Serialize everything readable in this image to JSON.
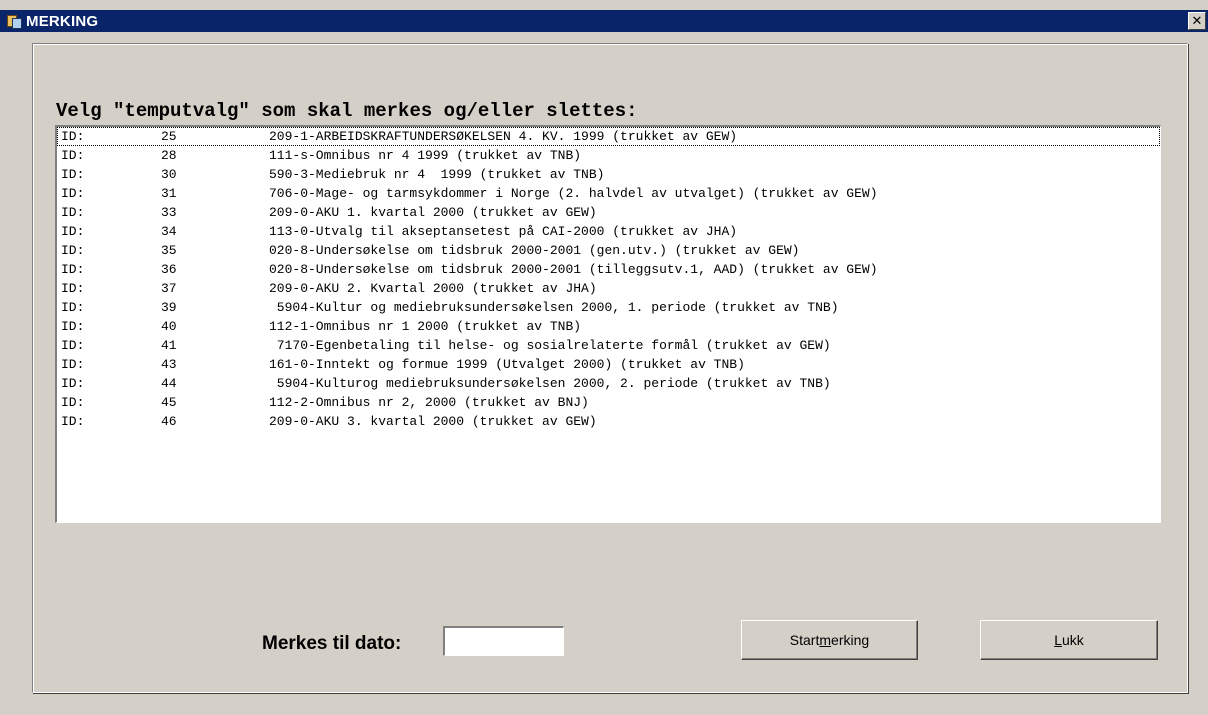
{
  "window": {
    "title": "MERKING",
    "close_glyph": "✕"
  },
  "heading": "Velg \"temputvalg\" som skal merkes og/eller slettes:",
  "list": {
    "items": [
      {
        "id_label": "ID:",
        "id": "25",
        "desc": "209-1-ARBEIDSKRAFTUNDERSØKELSEN 4. KV. 1999 (trukket av GEW)"
      },
      {
        "id_label": "ID:",
        "id": "28",
        "desc": "111-s-Omnibus nr 4 1999 (trukket av TNB)"
      },
      {
        "id_label": "ID:",
        "id": "30",
        "desc": "590-3-Mediebruk nr 4  1999 (trukket av TNB)"
      },
      {
        "id_label": "ID:",
        "id": "31",
        "desc": "706-0-Mage- og tarmsykdommer i Norge (2. halvdel av utvalget) (trukket av GEW)"
      },
      {
        "id_label": "ID:",
        "id": "33",
        "desc": "209-0-AKU 1. kvartal 2000 (trukket av GEW)"
      },
      {
        "id_label": "ID:",
        "id": "34",
        "desc": "113-0-Utvalg til akseptansetest på CAI-2000 (trukket av JHA)"
      },
      {
        "id_label": "ID:",
        "id": "35",
        "desc": "020-8-Undersøkelse om tidsbruk 2000-2001 (gen.utv.) (trukket av GEW)"
      },
      {
        "id_label": "ID:",
        "id": "36",
        "desc": "020-8-Undersøkelse om tidsbruk 2000-2001 (tilleggsutv.1, AAD) (trukket av GEW)"
      },
      {
        "id_label": "ID:",
        "id": "37",
        "desc": "209-0-AKU 2. Kvartal 2000 (trukket av JHA)"
      },
      {
        "id_label": "ID:",
        "id": "39",
        "desc": " 5904-Kultur og mediebruksundersøkelsen 2000, 1. periode (trukket av TNB)"
      },
      {
        "id_label": "ID:",
        "id": "40",
        "desc": "112-1-Omnibus nr 1 2000 (trukket av TNB)"
      },
      {
        "id_label": "ID:",
        "id": "41",
        "desc": " 7170-Egenbetaling til helse- og sosialrelaterte formål (trukket av GEW)"
      },
      {
        "id_label": "ID:",
        "id": "43",
        "desc": "161-0-Inntekt og formue 1999 (Utvalget 2000) (trukket av TNB)"
      },
      {
        "id_label": "ID:",
        "id": "44",
        "desc": " 5904-Kulturog mediebruksundersøkelsen 2000, 2. periode (trukket av TNB)"
      },
      {
        "id_label": "ID:",
        "id": "45",
        "desc": "112-2-Omnibus nr 2, 2000 (trukket av BNJ)"
      },
      {
        "id_label": "ID:",
        "id": "46",
        "desc": "209-0-AKU 3. kvartal 2000 (trukket av GEW)"
      }
    ]
  },
  "date_field": {
    "label": "Merkes til dato:",
    "value": ""
  },
  "buttons": {
    "start_pre": "Start ",
    "start_mnemonic": "m",
    "start_post": "erking",
    "close_mnemonic": "L",
    "close_post": "ukk"
  }
}
